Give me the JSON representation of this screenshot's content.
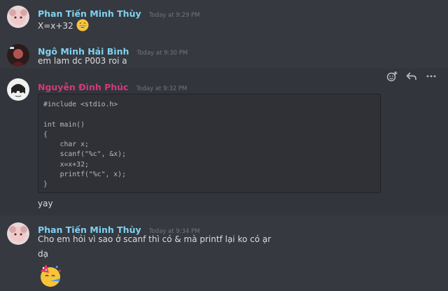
{
  "colors": {
    "background": "#36393f",
    "hover_background": "#32353b",
    "code_background": "#2f3136",
    "username_blue": "#7fd1f2",
    "username_pink": "#d13a7a",
    "timestamp": "#72767d",
    "text": "#dcddde"
  },
  "messages": [
    {
      "username": "Phan Tiến Minh Thùy",
      "timestamp": "Today at 9:29 PM",
      "lines": [
        "X=x+32"
      ],
      "emoji": "grinning-face-with-smiling-eyes"
    },
    {
      "username": "Ngô Minh Hải Bình",
      "timestamp": "Today at 9:30 PM",
      "lines": [
        "em lam dc P003 roi a"
      ]
    },
    {
      "username": "Nguyễn Đình Phúc",
      "timestamp": "Today at 9:32 PM",
      "code": "#include <stdio.h>\n\nint main()\n{\n    char x;\n    scanf(\"%c\", &x);\n    x=x+32;\n    printf(\"%c\", x);\n}",
      "lines": [
        "yay"
      ]
    },
    {
      "username": "Phan Tiến Minh Thùy",
      "timestamp": "Today at 9:34 PM",
      "lines": [
        "Cho em hỏi vì sao ở scanf thì có & mà printf lại ko có ạr",
        "dạ"
      ],
      "emoji": "partying-face"
    }
  ],
  "toolbar": {
    "icons": [
      "add-reaction-icon",
      "reply-icon",
      "more-icon"
    ]
  }
}
